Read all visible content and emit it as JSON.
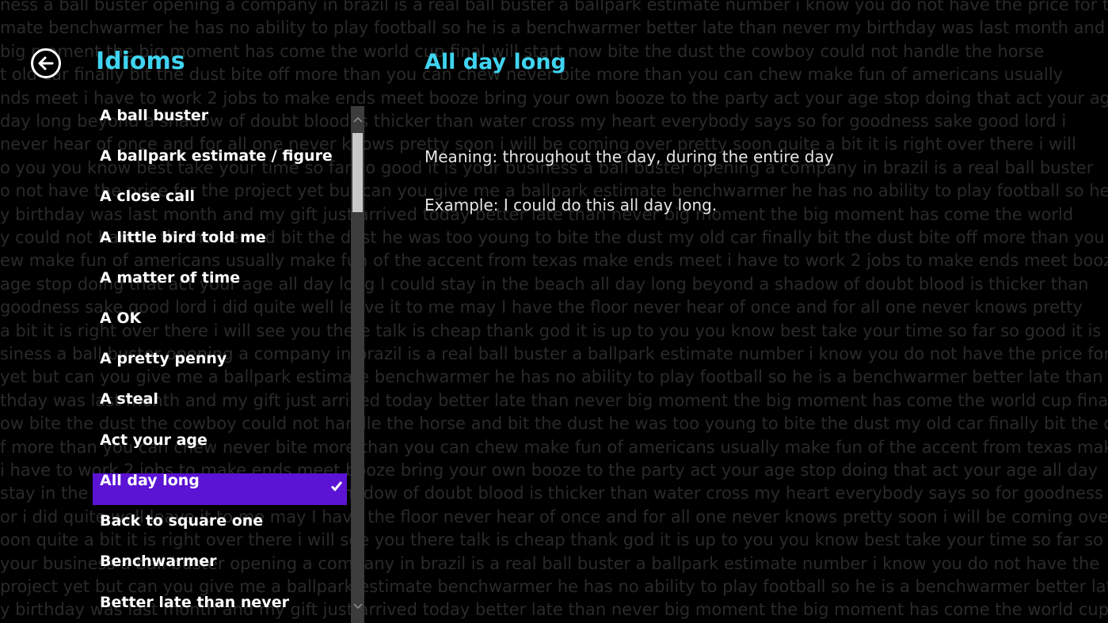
{
  "background_lines": [
    "ness a ball buster opening a company in brazil is a real ball buster  a ballpark estimate number i know you do not have the price for the",
    "mate benchwarmer he has no ability to play football so he is a benchwarmer better late than never my birthday was last month and",
    "big moment the big moment has come the world cup final will start now bite the dust the cowboy could not handle the horse",
    "t old car finally bit the dust bite off more than you can chew never bite more than you can chew make fun of americans usually",
    "nds meet i have to work 2 jobs to make ends meet booze bring your own booze to the party act your age stop doing that act your age",
    "day long beyond a shadow of doubt blood is thicker than water cross my heart everybody says so for goodness sake good lord i",
    "never hear of once and for all one never knows pretty soon i will be coming over pretty soon quite a bit it is right over there i will",
    "o you you know best take your time so far so good it is your business a ball buster opening a company in brazil is a real ball buster",
    "o not have the price for the project yet but can you give me a ballpark estimate benchwarmer he has no ability to play football so he",
    "y birthday was last month and my gift just arrived today better late than never big moment the big moment has come the world",
    "y could not handle the horse and bit the dust he was too young to bite the dust my old car finally bit the dust bite off more than you",
    "ew make fun of americans usually make fun of the accent from texas make ends meet i have to work 2 jobs to make ends meet booze",
    "age stop doing that act your age all day long I could stay in the beach all day long beyond a shadow of doubt blood is thicker than",
    "goodness sake good lord i did quite well leave it to me may I have the floor never hear of once and for all one never knows pretty",
    "a bit it is right over there i will see you there talk is cheap thank god it is up to you you know best take your time so far so good it is",
    "siness a ball buster opening a company in brazil is a real ball buster  a ballpark estimate number i know you do not have the price for",
    "yet but can you give me a ballpark estimate benchwarmer he has no ability to play football so he is a benchwarmer better late than never",
    "thday was last month and my gift just arrived today better late than never big moment the big moment has come the world cup final",
    "ow bite the dust the cowboy could not handle the horse and bit the dust he was too young to bite the dust my old car finally bit the dust",
    "f more than you can chew never bite more than you can chew make fun of americans usually make fun of the accent from texas make",
    " i have to work 2 jobs to make ends meet booze bring your own booze to the party act your age stop doing that act your age all day",
    " stay in the beach all day long beyond a shadow of doubt blood is thicker than water cross my heart everybody says so for goodness",
    "or i did quite well leave it to me may I have the floor never hear of once and for all one never knows pretty soon i will be coming over",
    "oon quite a bit it is right over there i will see you there talk is cheap thank god it is up to you you know best take your time so far so",
    " your business a ball buster opening a company in brazil is a real ball buster  a ballpark estimate number i know you do not have the",
    "project yet but can you give me a ballpark estimate benchwarmer he has no ability to play football so he is a benchwarmer better late",
    "y birthday was last month and my gift just arrived today better late than never big moment the big moment has come the world cup final"
  ],
  "header": {
    "app_title": "Idioms"
  },
  "detail": {
    "title": "All day long",
    "meaning": "Meaning: throughout the day, during the entire day",
    "example": "Example: I could do this all day long."
  },
  "list": {
    "items": [
      {
        "label": "A ball buster"
      },
      {
        "label": "A ballpark estimate / figure"
      },
      {
        "label": "A close call"
      },
      {
        "label": "A little bird told me"
      },
      {
        "label": "A matter of time"
      },
      {
        "label": "A OK"
      },
      {
        "label": "A pretty penny"
      },
      {
        "label": "A steal"
      },
      {
        "label": "Act your age"
      },
      {
        "label": "All day long",
        "selected": true
      },
      {
        "label": "Back to square one"
      },
      {
        "label": "Benchwarmer"
      },
      {
        "label": "Better late than never"
      }
    ]
  },
  "colors": {
    "accent": "#3fd4f0",
    "selection": "#5b13d4",
    "background": "#000000",
    "watermark_text": "#2a2a2a"
  },
  "icons": {
    "back": "arrow-left-circle-icon",
    "selected": "checkmark-icon",
    "scroll_up": "chevron-up-icon",
    "scroll_down": "chevron-down-icon"
  }
}
